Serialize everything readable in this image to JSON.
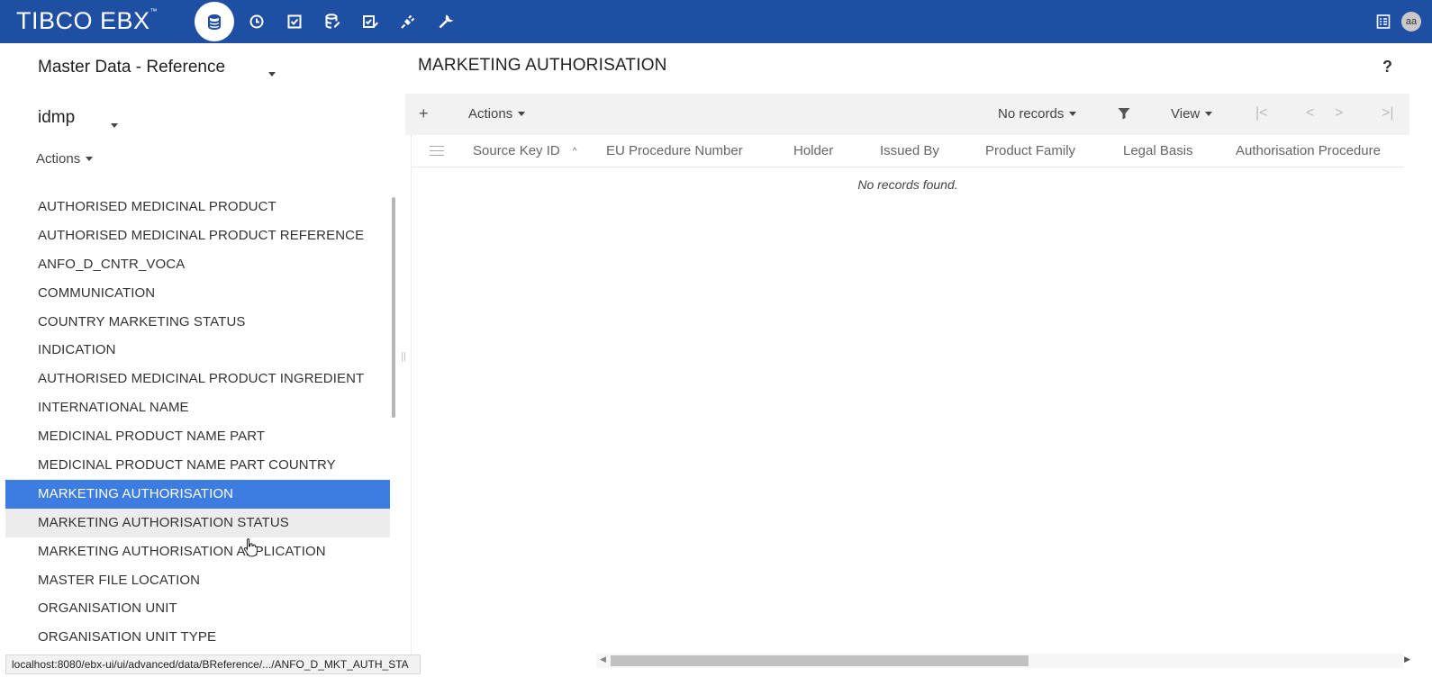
{
  "header": {
    "logo": "TIBCO EBX",
    "nav_icons": [
      "database-icon",
      "clock-icon",
      "checkbox-icon",
      "data-model-icon",
      "task-icon",
      "plug-icon",
      "wrench-icon"
    ],
    "right_icons": [
      "list-icon"
    ],
    "avatar_initials": "aa",
    "brand_color": "#1f4fa3"
  },
  "sidebar": {
    "dataspace": "Master Data - Reference",
    "dataset": "idmp",
    "actions_label": "Actions",
    "tables": [
      "AUTHORISED MEDICINAL PRODUCT",
      "AUTHORISED MEDICINAL PRODUCT REFERENCE",
      "ANFO_D_CNTR_VOCA",
      "COMMUNICATION",
      "COUNTRY MARKETING STATUS",
      "INDICATION",
      "AUTHORISED MEDICINAL PRODUCT INGREDIENT",
      "INTERNATIONAL NAME",
      "MEDICINAL PRODUCT NAME PART",
      "MEDICINAL PRODUCT NAME PART COUNTRY",
      "MARKETING AUTHORISATION",
      "MARKETING AUTHORISATION STATUS",
      "MARKETING AUTHORISATION APPLICATION",
      "MASTER FILE LOCATION",
      "ORGANISATION UNIT",
      "ORGANISATION UNIT TYPE"
    ],
    "selected_color": "#3d7ce0"
  },
  "main": {
    "title": "MARKETING AUTHORISATION",
    "help_label": "?",
    "toolbar": {
      "add_label": "+",
      "actions_label": "Actions",
      "records_label": "No records",
      "view_label": "View"
    },
    "columns": [
      "Source Key ID",
      "EU Procedure Number",
      "Holder",
      "Issued By",
      "Product Family",
      "Legal Basis",
      "Authorisation Procedure"
    ],
    "empty_message": "No records found."
  },
  "status_bar": {
    "url": "localhost:8080/ebx-ui/ui/advanced/data/BReference/.../ANFO_D_MKT_AUTH_STA"
  }
}
